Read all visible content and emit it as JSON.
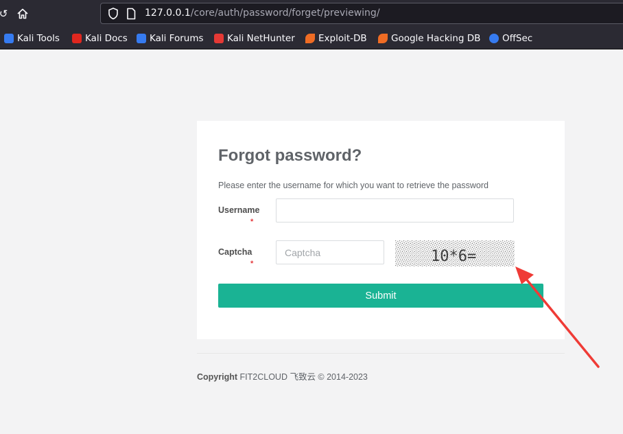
{
  "browser": {
    "url_host": "127.0.0.1",
    "url_path": "/core/auth/password/forget/previewing/",
    "bookmarks": [
      {
        "label": "Kali Tools",
        "icon": "kali-tools-icon",
        "color": "#367bf0"
      },
      {
        "label": "Kali Docs",
        "icon": "kali-docs-icon",
        "color": "#e0271f"
      },
      {
        "label": "Kali Forums",
        "icon": "kali-forums-icon",
        "color": "#367bf0"
      },
      {
        "label": "Kali NetHunter",
        "icon": "kali-nethunter-icon",
        "color": "#e53935"
      },
      {
        "label": "Exploit-DB",
        "icon": "exploit-db-icon",
        "color": "#ef6c24"
      },
      {
        "label": "Google Hacking DB",
        "icon": "ghdb-icon",
        "color": "#ef6c24"
      },
      {
        "label": "OffSec",
        "icon": "offsec-icon",
        "color": "#367bf0"
      }
    ]
  },
  "form": {
    "title": "Forgot password?",
    "description": "Please enter the username for which you want to retrieve the password",
    "username_label": "Username",
    "username_value": "",
    "captcha_label": "Captcha",
    "captcha_placeholder": "Captcha",
    "captcha_text": "10*6=",
    "required_mark": "*",
    "submit_label": "Submit"
  },
  "footer": {
    "copyright_label": "Copyright",
    "copyright_text": "FIT2CLOUD 飞致云 © 2014-2023"
  },
  "colors": {
    "accent": "#1ab394",
    "required": "#e4393c",
    "annotation_arrow": "#ef3b36"
  }
}
